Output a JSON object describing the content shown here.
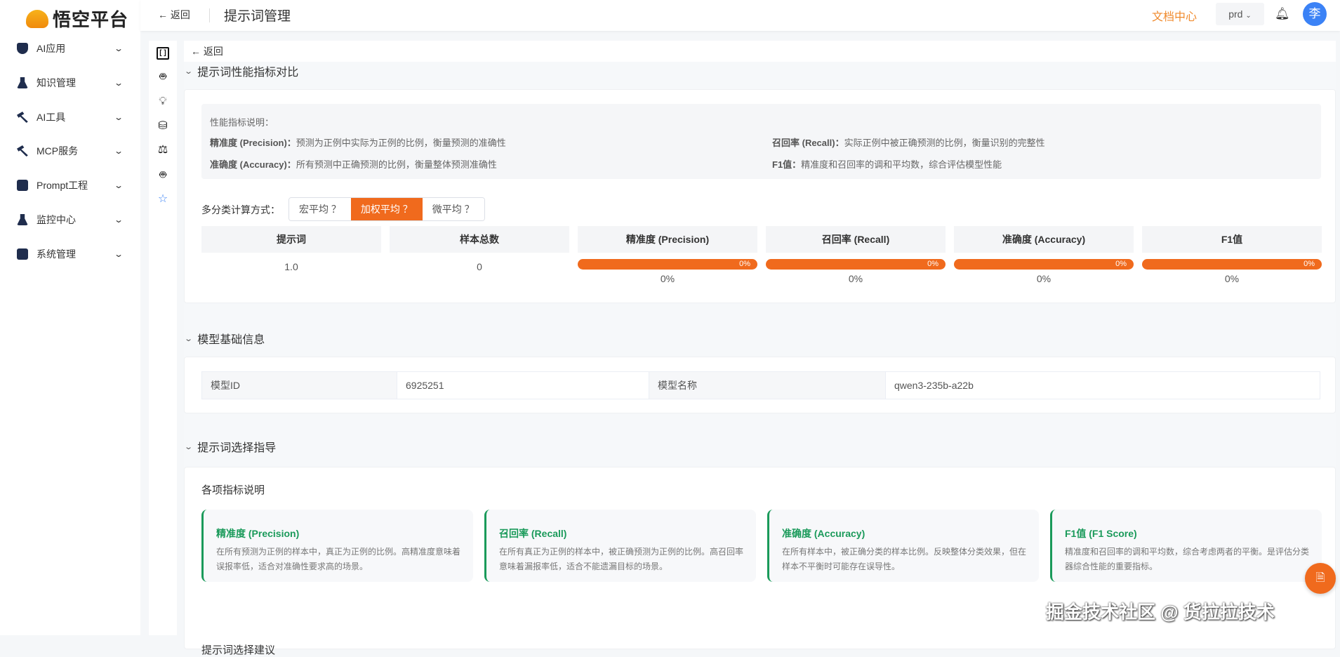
{
  "brand": {
    "name": "悟空平台"
  },
  "sidebar": {
    "items": [
      {
        "label": "AI应用",
        "icon": "angular-shield-icon"
      },
      {
        "label": "知识管理",
        "icon": "flask-icon"
      },
      {
        "label": "AI工具",
        "icon": "hammer-icon"
      },
      {
        "label": "MCP服务",
        "icon": "hammer-icon"
      },
      {
        "label": "Prompt工程",
        "icon": "folder-icon"
      },
      {
        "label": "监控中心",
        "icon": "flask-icon"
      },
      {
        "label": "系统管理",
        "icon": "briefcase-icon"
      }
    ]
  },
  "topbar": {
    "back": "返回",
    "title": "提示词管理",
    "docs": "文档中心",
    "env": "prd",
    "avatar": "李"
  },
  "content": {
    "back": "返回",
    "perf": {
      "title": "提示词性能指标对比",
      "info_title": "性能指标说明：",
      "lines": [
        {
          "term": "精准度 (Precision)：",
          "desc": "预测为正例中实际为正例的比例，衡量预测的准确性"
        },
        {
          "term": "召回率 (Recall)：",
          "desc": "实际正例中被正确预测的比例，衡量识别的完整性"
        },
        {
          "term": "准确度 (Accuracy)：",
          "desc": "所有预测中正确预测的比例，衡量整体预测准确性"
        },
        {
          "term": "F1值：",
          "desc": "精准度和召回率的调和平均数，综合评估模型性能"
        }
      ],
      "method_label": "多分类计算方式：",
      "methods": [
        "宏平均 ？",
        "加权平均 ？",
        "微平均 ？"
      ],
      "selected_method": "加权平均",
      "headers": [
        "提示词",
        "样本总数",
        "精准度 (Precision)",
        "召回率 (Recall)",
        "准确度 (Accuracy)",
        "F1值"
      ],
      "row": {
        "prompt": "1.0",
        "samples": "0",
        "metrics": [
          {
            "bar": "0%",
            "value": "0%"
          },
          {
            "bar": "0%",
            "value": "0%"
          },
          {
            "bar": "0%",
            "value": "0%"
          },
          {
            "bar": "0%",
            "value": "0%"
          }
        ]
      }
    },
    "model": {
      "title": "模型基础信息",
      "id_label": "模型ID",
      "id": "6925251",
      "name_label": "模型名称",
      "name": "qwen3-235b-a22b"
    },
    "guide": {
      "title": "提示词选择指导",
      "sub1": "各项指标说明",
      "sub2": "提示词选择建议",
      "cards": [
        {
          "title": "精准度 (Precision)",
          "desc": "在所有预测为正例的样本中，真正为正例的比例。高精准度意味着误报率低，适合对准确性要求高的场景。"
        },
        {
          "title": "召回率 (Recall)",
          "desc": "在所有真正为正例的样本中，被正确预测为正例的比例。高召回率意味着漏报率低，适合不能遗漏目标的场景。"
        },
        {
          "title": "准确度 (Accuracy)",
          "desc": "在所有样本中，被正确分类的样本比例。反映整体分类效果，但在样本不平衡时可能存在误导性。"
        },
        {
          "title": "F1值 (F1 Score)",
          "desc": "精准度和召回率的调和平均数，综合考虑两者的平衡。是评估分类器综合性能的重要指标。"
        }
      ]
    }
  },
  "watermark": "掘金技术社区 @ 货拉拉技术",
  "colors": {
    "accent": "#f06a1d",
    "green": "#1a9a5a",
    "avatar": "#3b82f6"
  }
}
